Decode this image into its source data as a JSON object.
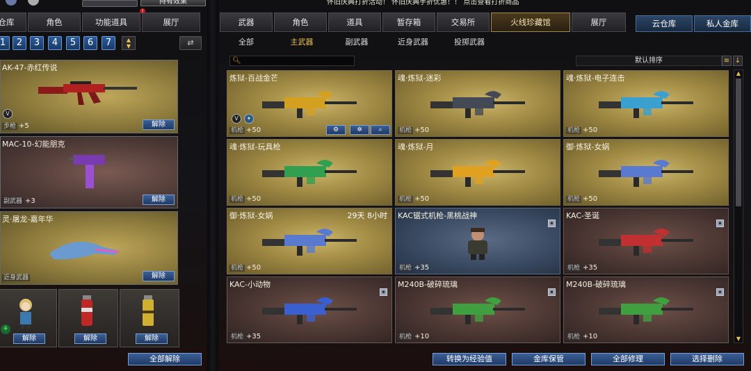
{
  "notice": {
    "text": "怀旧庆典打折活动！ 怀旧庆典手折优惠！！ 点击查看打折商品"
  },
  "left_panel": {
    "top_button": "持有效果",
    "tabs": [
      {
        "label": "仓库"
      },
      {
        "label": "角色"
      },
      {
        "label": "功能道具"
      },
      {
        "label": "展厅"
      }
    ],
    "pages": [
      "1",
      "2",
      "3",
      "4",
      "5",
      "6",
      "7"
    ],
    "items": [
      {
        "name": "AK-47-赤红传说",
        "category": "步枪",
        "level": "+5",
        "action": "解除"
      },
      {
        "name": "MAC-10-幻能朋克",
        "category": "副武器",
        "level": "+3",
        "action": "解除"
      },
      {
        "name": "灵·屠龙-嘉年华",
        "category": "近身武器",
        "level": "",
        "action": "解除"
      }
    ],
    "slots": [
      {
        "action": "解除"
      },
      {
        "action": "解除"
      },
      {
        "action": "解除"
      }
    ],
    "unequip_all": "全部解除"
  },
  "main_tabs": [
    {
      "label": "武器",
      "active": false
    },
    {
      "label": "角色",
      "active": false
    },
    {
      "label": "道具",
      "active": false
    },
    {
      "label": "暂存箱",
      "active": false
    },
    {
      "label": "交易所",
      "active": false
    },
    {
      "label": "火线珍藏馆",
      "active": true
    },
    {
      "label": "展厅",
      "active": false
    }
  ],
  "side_tabs": [
    {
      "label": "云仓库"
    },
    {
      "label": "私人金库"
    }
  ],
  "sub_tabs": [
    {
      "label": "全部",
      "active": false
    },
    {
      "label": "主武器",
      "active": true
    },
    {
      "label": "副武器",
      "active": false
    },
    {
      "label": "近身武器",
      "active": false
    },
    {
      "label": "投掷武器",
      "active": false
    }
  ],
  "search": {
    "icon": "search-icon",
    "value": ""
  },
  "sort": {
    "label": "默认排序"
  },
  "cards": [
    {
      "name": "炼狱-百战金芒",
      "category": "机枪",
      "level": "+50",
      "rarity": "gold",
      "time": "",
      "trash": false,
      "actions": true,
      "color": "#d4a020"
    },
    {
      "name": "魂·炼狱-迷彩",
      "category": "机枪",
      "level": "+50",
      "rarity": "gold",
      "time": "",
      "trash": false,
      "actions": false,
      "color": "#444a55"
    },
    {
      "name": "魂·炼狱-电子连击",
      "category": "机枪",
      "level": "+50",
      "rarity": "gold",
      "time": "",
      "trash": false,
      "actions": false,
      "color": "#3aa0d0"
    },
    {
      "name": "魂·炼狱-玩具枪",
      "category": "机枪",
      "level": "+50",
      "rarity": "gold",
      "time": "",
      "trash": false,
      "actions": false,
      "color": "#30a050"
    },
    {
      "name": "魂·炼狱-月",
      "category": "机枪",
      "level": "+50",
      "rarity": "gold",
      "time": "",
      "trash": false,
      "actions": false,
      "color": "#e0a020"
    },
    {
      "name": "御·炼狱-女娲",
      "category": "机枪",
      "level": "+50",
      "rarity": "gold",
      "time": "",
      "trash": false,
      "actions": false,
      "color": "#5a7ad0"
    },
    {
      "name": "御·炼狱-女娲",
      "category": "机枪",
      "level": "+50",
      "rarity": "gold",
      "time": "29天 8小时",
      "trash": false,
      "actions": false,
      "color": "#5a7ad0"
    },
    {
      "name": "KAC锯式机枪-黑桃战神",
      "category": "机枪",
      "level": "+35",
      "rarity": "blue",
      "time": "",
      "trash": true,
      "actions": false,
      "color": "#3a3a3a"
    },
    {
      "name": "KAC-圣诞",
      "category": "机枪",
      "level": "+35",
      "rarity": "brown",
      "time": "",
      "trash": true,
      "actions": false,
      "color": "#c03030"
    },
    {
      "name": "KAC-小动物",
      "category": "机枪",
      "level": "+35",
      "rarity": "brown",
      "time": "",
      "trash": true,
      "actions": false,
      "color": "#3a60d0"
    },
    {
      "name": "M240B-破碎琉璃",
      "category": "机枪",
      "level": "+10",
      "rarity": "brown",
      "time": "",
      "trash": true,
      "actions": false,
      "color": "#40a040"
    },
    {
      "name": "M240B-破碎琉璃",
      "category": "机枪",
      "level": "+10",
      "rarity": "brown",
      "time": "",
      "trash": true,
      "actions": false,
      "color": "#40a040"
    }
  ],
  "bottom_buttons": [
    {
      "label": "转换为经验值"
    },
    {
      "label": "金库保管"
    },
    {
      "label": "全部修理"
    },
    {
      "label": "选择删除"
    }
  ]
}
